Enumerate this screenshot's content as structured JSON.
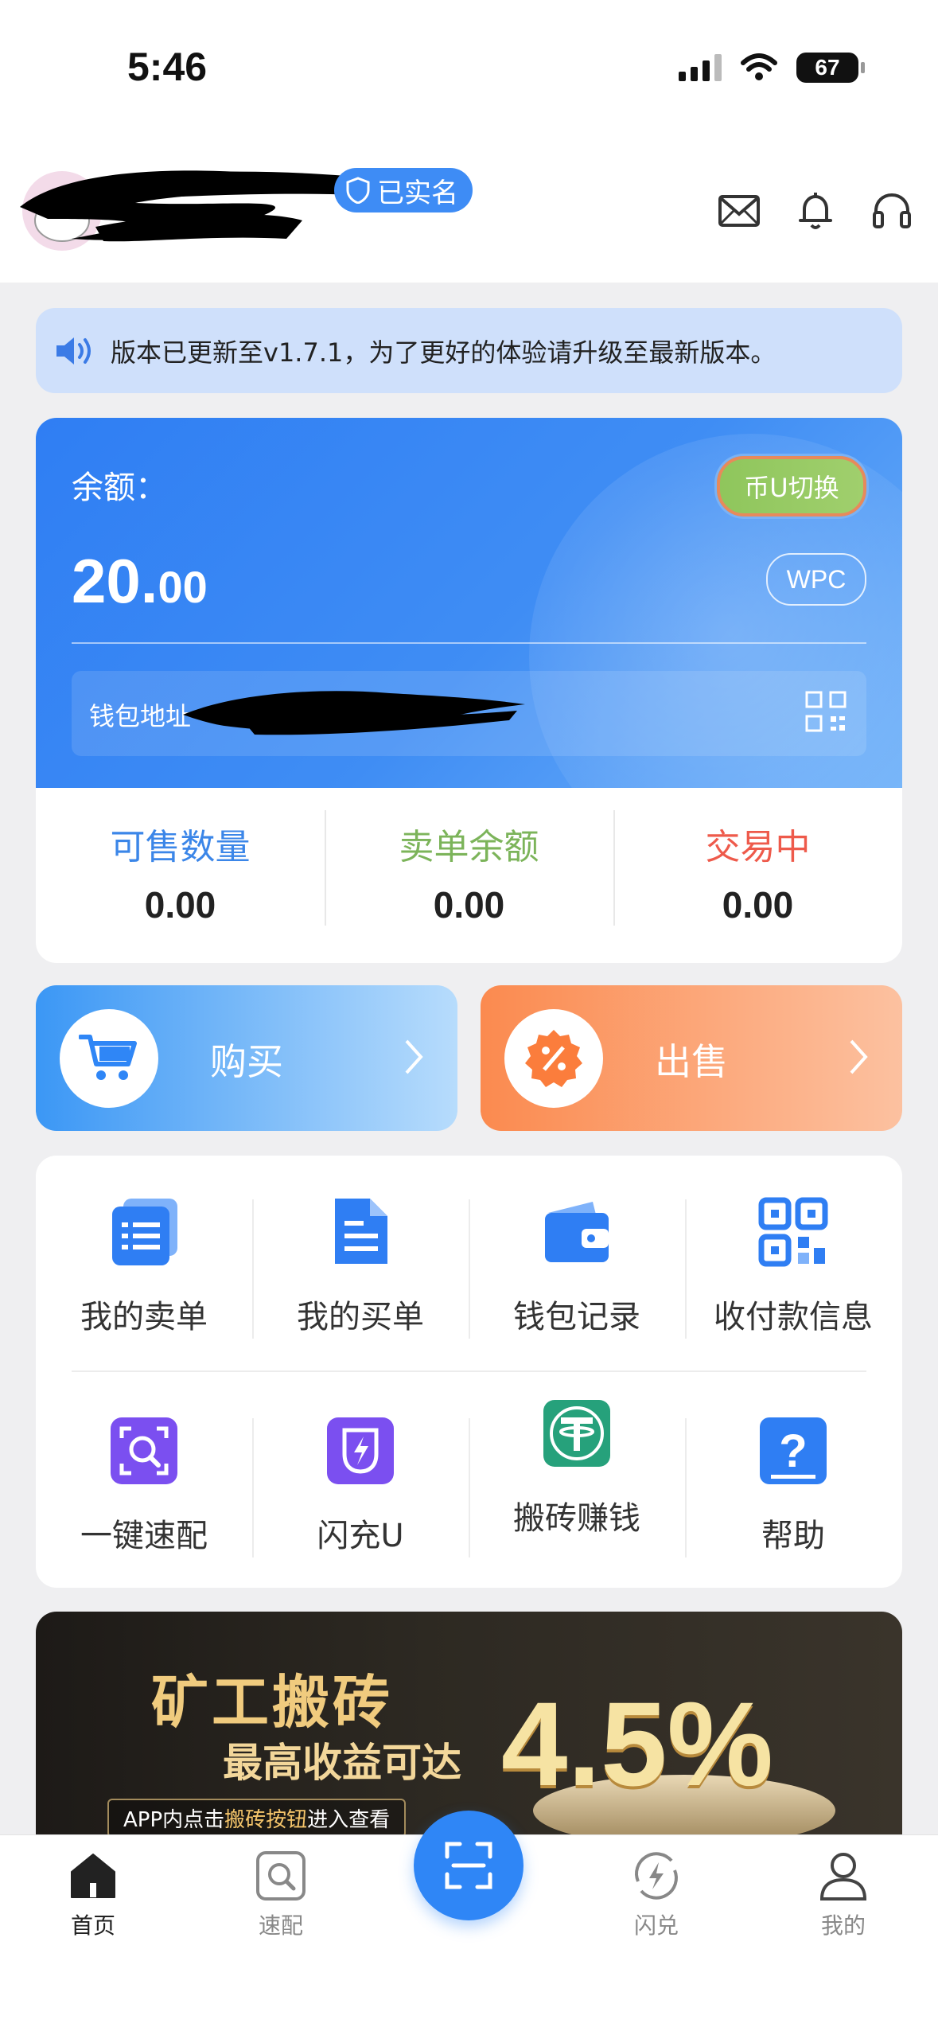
{
  "status_bar": {
    "time": "5:46",
    "battery": "67"
  },
  "header": {
    "verified_label": "已实名"
  },
  "notice": {
    "text": "版本已更新至v1.7.1，为了更好的体验请升级至最新版本。"
  },
  "balance": {
    "label": "余额：",
    "amount_int": "20.",
    "amount_dec": "00",
    "switch_label": "币U切换",
    "currency_label": "WPC",
    "wallet_label": "钱包地址"
  },
  "stats": [
    {
      "label": "可售数量",
      "value": "0.00",
      "color": "#3b86e8"
    },
    {
      "label": "卖单余额",
      "value": "0.00",
      "color": "#7cb45a"
    },
    {
      "label": "交易中",
      "value": "0.00",
      "color": "#ee5a4b"
    }
  ],
  "actions": {
    "buy_label": "购买",
    "sell_label": "出售"
  },
  "grid": {
    "row1": [
      {
        "label": "我的卖单",
        "icon": "sell-orders-icon"
      },
      {
        "label": "我的买单",
        "icon": "buy-orders-icon"
      },
      {
        "label": "钱包记录",
        "icon": "wallet-records-icon"
      },
      {
        "label": "收付款信息",
        "icon": "payment-info-icon"
      }
    ],
    "row2": [
      {
        "label": "一键速配",
        "icon": "quick-match-icon"
      },
      {
        "label": "闪充U",
        "icon": "flash-charge-icon"
      },
      {
        "label": "搬砖赚钱",
        "icon": "tether-icon"
      },
      {
        "label": "帮助",
        "icon": "help-icon"
      }
    ]
  },
  "banner": {
    "title": "矿工搬砖",
    "subtitle": "最高收益可达",
    "percent": "4.5%",
    "hint_pre": "APP内点击",
    "hint_highlight": "搬砖按钮",
    "hint_post": "进入查看"
  },
  "tabbar": {
    "home": "首页",
    "match": "速配",
    "flash": "闪兑",
    "mine": "我的"
  },
  "colors": {
    "primary": "#2f86f6",
    "sell": "#fb8a4f",
    "notice_bg": "#cfe0fb"
  }
}
